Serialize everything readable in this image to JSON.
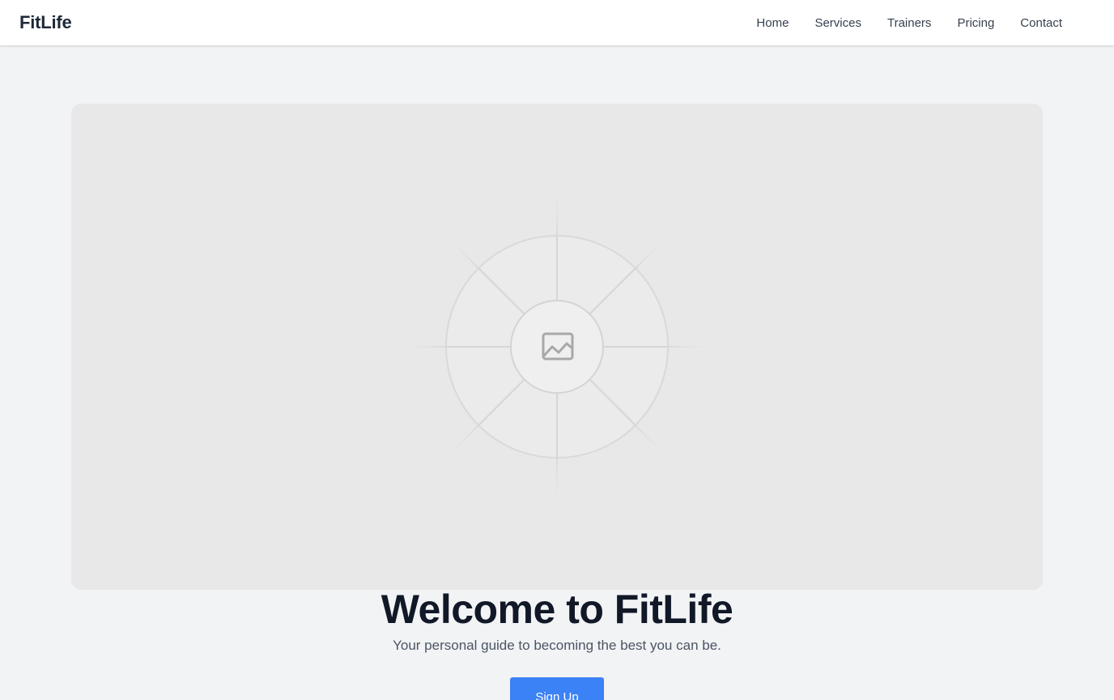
{
  "navbar": {
    "brand": "FitLife",
    "links": [
      "Home",
      "Services",
      "Trainers",
      "Pricing",
      "Contact"
    ]
  },
  "hero": {
    "image_icon": "image-placeholder-icon",
    "title": "Welcome to FitLife",
    "subtitle": "Your personal guide to becoming the best you can be.",
    "cta_label": "Sign Up"
  },
  "colors": {
    "page_background": "#f2f3f5",
    "navbar_background": "#ffffff",
    "image_background": "#e8e8e9",
    "accent": "#3b82f6",
    "heading": "#111827",
    "body_text": "#4b5563"
  }
}
